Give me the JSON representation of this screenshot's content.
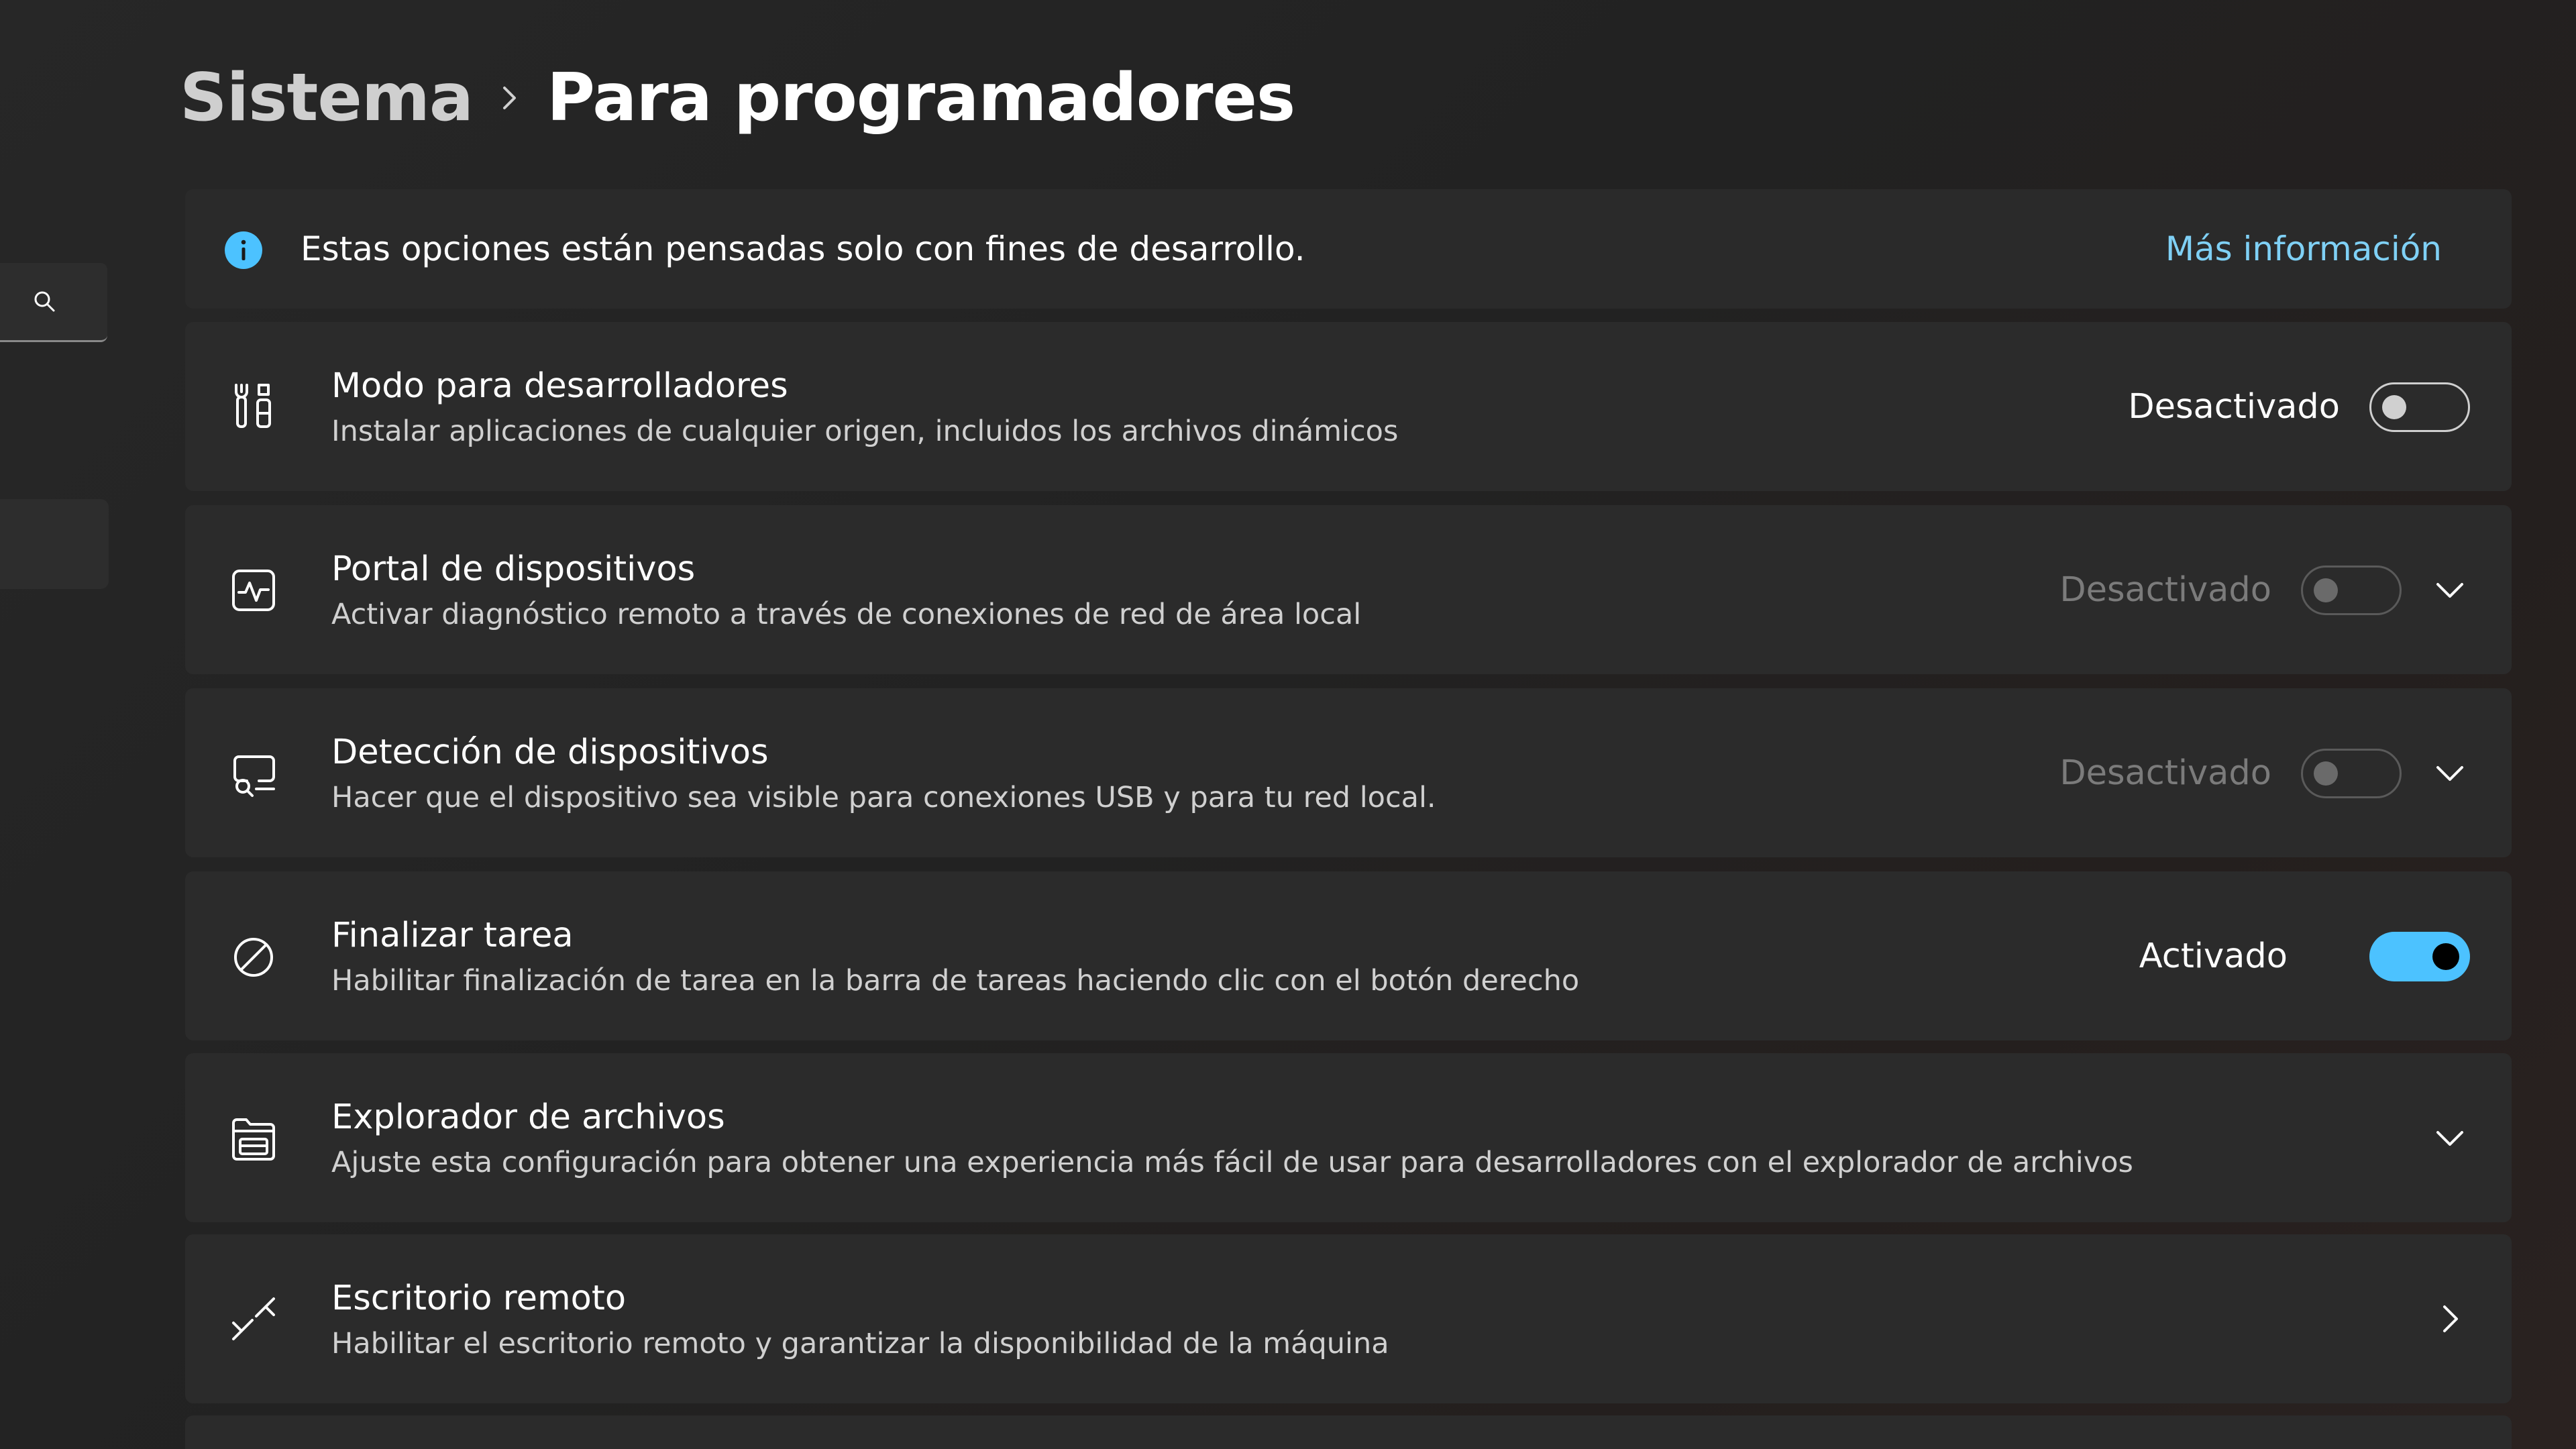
{
  "header": {
    "parent": "Sistema",
    "current": "Para programadores"
  },
  "sidebar": {
    "search_icon": "search-icon"
  },
  "info_bar": {
    "text": "Estas opciones están pensadas solo con fines de desarrollo.",
    "link": "Más información",
    "icon": "info-icon",
    "accent_color": "#4cc2ff"
  },
  "settings": [
    {
      "title": "Modo para desarrolladores",
      "description": "Instalar aplicaciones de cualquier origen, incluidos los archivos dinámicos",
      "state": "Desactivado",
      "toggle_on": false,
      "enabled": true,
      "icon": "developer-tools-icon"
    },
    {
      "title": "Portal de dispositivos",
      "description": "Activar diagnóstico remoto a través de conexiones de red de área local",
      "state": "Desactivado",
      "toggle_on": false,
      "enabled": false,
      "expand": true,
      "icon": "device-portal-icon"
    },
    {
      "title": "Detección de dispositivos",
      "description": "Hacer que el dispositivo sea visible para conexiones USB y para tu red local.",
      "state": "Desactivado",
      "toggle_on": false,
      "enabled": false,
      "expand": true,
      "icon": "device-discovery-icon"
    },
    {
      "title": "Finalizar tarea",
      "description": "Habilitar finalización de tarea en la barra de tareas haciendo clic con el botón derecho",
      "state": "Activado",
      "toggle_on": true,
      "enabled": true,
      "icon": "end-task-icon"
    },
    {
      "title": "Explorador de archivos",
      "description": "Ajuste esta configuración para obtener una experiencia más fácil de usar para desarrolladores con el explorador de archivos",
      "expand": true,
      "icon": "file-explorer-icon"
    },
    {
      "title": "Escritorio remoto",
      "description": "Habilitar el escritorio remoto y garantizar la disponibilidad de la máquina",
      "navigate": true,
      "icon": "remote-desktop-icon"
    }
  ],
  "colors": {
    "accent": "#4cc2ff",
    "link": "#7fd0f5",
    "card": "#2b2b2b",
    "background": "#202020"
  }
}
